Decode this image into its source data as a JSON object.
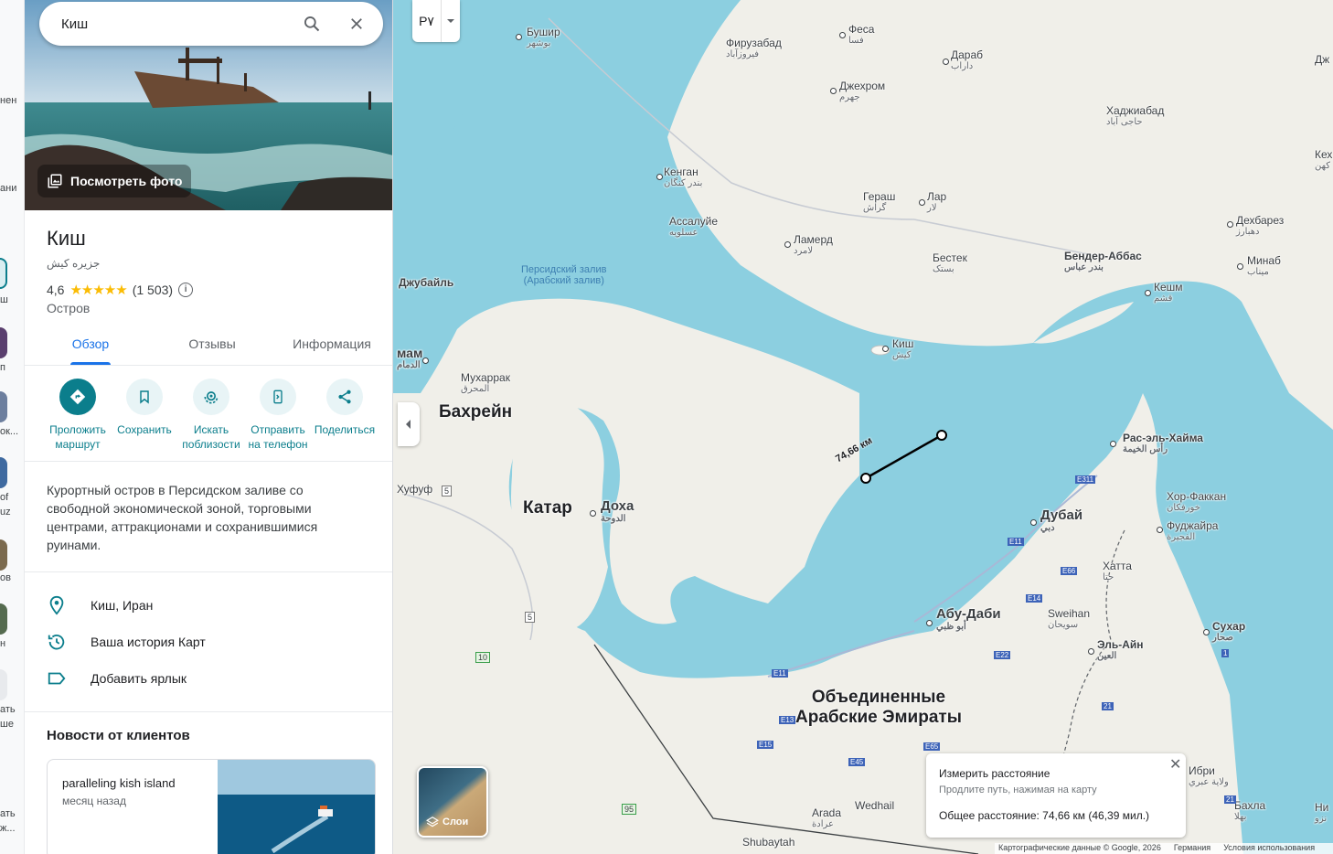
{
  "search": {
    "query": "Киш"
  },
  "hero": {
    "view_photos_label": "Посмотреть фото"
  },
  "place": {
    "title": "Киш",
    "subtitle": "جزیره کیش",
    "rating": "4,6",
    "stars": "★★★★★",
    "reviews_count": "(1 503)",
    "category": "Остров"
  },
  "tabs": [
    {
      "label": "Обзор",
      "active": true
    },
    {
      "label": "Отзывы",
      "active": false
    },
    {
      "label": "Информация",
      "active": false
    }
  ],
  "actions": [
    {
      "label_line1": "Проложить",
      "label_line2": "маршрут",
      "icon": "directions-icon"
    },
    {
      "label_line1": "Сохранить",
      "label_line2": "",
      "icon": "bookmark-icon"
    },
    {
      "label_line1": "Искать",
      "label_line2": "поблизости",
      "icon": "nearby-icon"
    },
    {
      "label_line1": "Отправить",
      "label_line2": "на телефон",
      "icon": "send-to-phone-icon"
    },
    {
      "label_line1": "Поделиться",
      "label_line2": "",
      "icon": "share-icon"
    }
  ],
  "description": "Курортный остров в Персидском заливе со свободной экономической зоной, торговыми центрами, аттракционами и сохранившимися руинами.",
  "info_rows": [
    {
      "icon": "location-pin-icon",
      "text": "Киш, Иран"
    },
    {
      "icon": "history-icon",
      "text": "Ваша история Карт"
    },
    {
      "icon": "label-icon",
      "text": "Добавить ярлык"
    }
  ],
  "news": {
    "title": "Новости от клиентов",
    "card_text": "paralleling kish island",
    "card_time": "месяц назад"
  },
  "rail": {
    "texts": [
      "нен",
      "ани",
      "ш",
      "п",
      "ок...",
      "of",
      "uz",
      "ов",
      "н",
      "ать",
      "ше",
      "ать",
      "ж..."
    ]
  },
  "map": {
    "script_toggle": "Р۷",
    "labels": {
      "bushehr": "Бушир",
      "bushehr_fa": "بوشهر",
      "firuzabad": "Фирузабад",
      "firuzabad_fa": "فیروزآباد",
      "fasa": "Феса",
      "fasa_fa": "فسا",
      "darab": "Дараб",
      "darab_fa": "داراب",
      "jahrom": "Джехром",
      "jahrom_fa": "جهرم",
      "hajiabad": "Хаджиабад",
      "hajiabad_fa": "حاجی آباد",
      "kangan": "Кенган",
      "kangan_fa": "بندر کنگان",
      "gerash": "Гераш",
      "gerash_fa": "گراش",
      "lar": "Лар",
      "lar_fa": "لار",
      "asaluyeh": "Ассалуйе",
      "asaluyeh_fa": "عسلویه",
      "lamerd": "Ламерд",
      "lamerd_fa": "لامرد",
      "bastak": "Бестек",
      "bastak_fa": "بستک",
      "bandar_abbas": "Бендер-Аббас",
      "bandar_abbas_fa": "بندر عباس",
      "minab": "Минаб",
      "minab_fa": "میناب",
      "dehbarez": "Дехбарез",
      "dehbarez_fa": "دهبارز",
      "kahnuj": "Кех",
      "kahnuj_fa": "کهن",
      "jiroft": "Дж",
      "qeshm": "Кешм",
      "qeshm_fa": "قشم",
      "gulf_line1": "Персидский залив",
      "gulf_line2": "(Арабский залив)",
      "jubail": "Джубайль",
      "dammam": "мам",
      "dammam_fa": "الدمام",
      "muharraq": "Мухаррак",
      "muharraq_fa": "المحرق",
      "bahrain": "Бахрейн",
      "hofuf": "Хуфуф",
      "kish": "Киш",
      "kish_fa": "کیش",
      "qatar": "Катар",
      "doha": "Доха",
      "doha_fa": "الدوحة",
      "rak": "Рас-эль-Хайма",
      "rak_fa": "رأس الخيمة",
      "khorfakkan": "Хор-Факкан",
      "khorfakkan_fa": "خورفكان",
      "fujairah": "Фуджайра",
      "fujairah_fa": "الفجيرة",
      "dubai": "Дубай",
      "dubai_fa": "دبي",
      "hatta": "Хатта",
      "hatta_fa": "حتا",
      "abudhabi": "Абу-Даби",
      "abudhabi_fa": "أبو ظبي",
      "sweihan": "Sweihan",
      "sweihan_fa": "سويحان",
      "alain": "Эль-Айн",
      "alain_fa": "العين",
      "sohar": "Сухар",
      "sohar_fa": "صحار",
      "uae_line1": "Объединенные",
      "uae_line2": "Арабские Эмираты",
      "ibri": "Ибри",
      "ibri_fa": "ولاية عبري",
      "bahla": "Бахла",
      "bahla_fa": "بهلا",
      "nizwa": "Ни",
      "nizwa_fa": "نزو",
      "arada": "Arada",
      "arada_fa": "عرادة",
      "wedhail": "Wedhail",
      "shubaytah": "Shubaytah",
      "distance_on_map": "74,66 км"
    },
    "roads": [
      "5",
      "5",
      "10",
      "95",
      "E11",
      "E11",
      "E11",
      "E13",
      "E15",
      "E45",
      "E65",
      "E66",
      "E14",
      "E22",
      "E311",
      "21",
      "21",
      "1"
    ],
    "layers_label": "Слои",
    "footer": {
      "data": "Картографические данные © Google, 2026",
      "country": "Германия",
      "terms": "Условия использования"
    }
  },
  "measure": {
    "title": "Измерить расстояние",
    "hint": "Продлите путь, нажимая на карту",
    "total": "Общее расстояние: 74,66 км (46,39 мил.)"
  },
  "colors": {
    "accent": "#0b7e8c",
    "tab_active": "#1a73e8",
    "water": "#8ccfe0",
    "land": "#f0efe9",
    "star": "#fbbc04"
  }
}
